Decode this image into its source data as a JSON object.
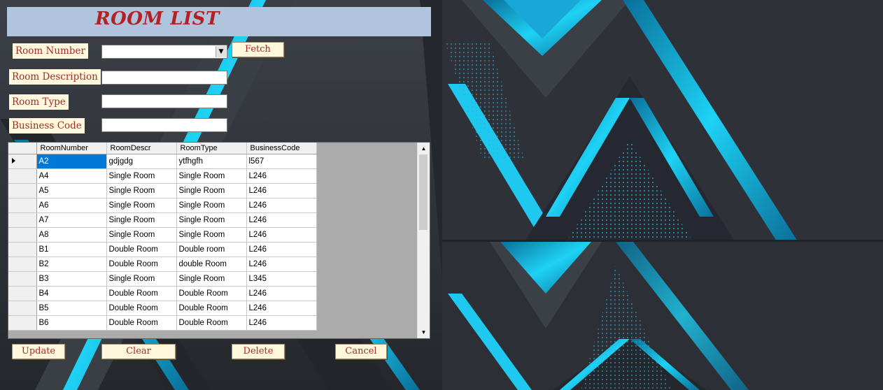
{
  "window": {
    "title": "ROOM LIST"
  },
  "form": {
    "room_number_label": "Room Number",
    "room_description_label": "Room Description",
    "room_type_label": "Room Type",
    "business_code_label": "Business Code",
    "room_number_value": "",
    "room_description_value": "",
    "room_type_value": "",
    "business_code_value": "",
    "fetch_label": "Fetch"
  },
  "grid": {
    "columns": [
      "RoomNumber",
      "RoomDescr",
      "RoomType",
      "BusinessCode"
    ],
    "rows": [
      [
        "A2",
        "gdjgdg",
        "ytfhgfh",
        "l567"
      ],
      [
        "A4",
        "Single Room",
        "Single Room",
        "L246"
      ],
      [
        "A5",
        "Single Room",
        "Single Room",
        "L246"
      ],
      [
        "A6",
        "Single Room",
        "Single Room",
        "L246"
      ],
      [
        "A7",
        "Single Room",
        "Single Room",
        "L246"
      ],
      [
        "A8",
        "Single Room",
        "Single Room",
        "L246"
      ],
      [
        "B1",
        "Double Room",
        "Double room",
        "L246"
      ],
      [
        "B2",
        "Double Room",
        "double  Room",
        "L246"
      ],
      [
        "B3",
        "Single Room",
        "Single Room",
        "L345"
      ],
      [
        "B4",
        "Double Room",
        "Double Room",
        "L246"
      ],
      [
        "B5",
        "Double Room",
        "Double Room",
        "L246"
      ],
      [
        "B6",
        "Double Room",
        "Double Room",
        "L246"
      ]
    ],
    "selected_row": 0
  },
  "buttons": {
    "update": "Update",
    "clear": "Clear",
    "delete": "Delete",
    "cancel": "Cancel"
  },
  "colors": {
    "title_bar": "#b0c4de",
    "title_text": "#b22222",
    "label_bg": "#fff8dc",
    "label_text": "#a52a2a",
    "selection": "#0078d7",
    "accent_cyan": "#14c8f0"
  }
}
